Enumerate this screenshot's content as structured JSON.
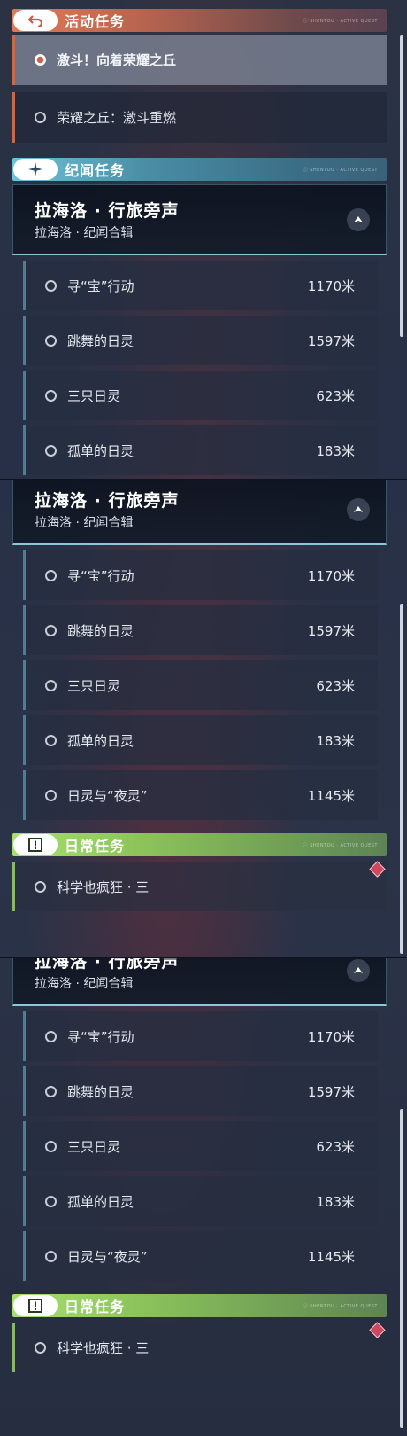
{
  "activity": {
    "title": "活动任务",
    "badge_icon": "return-arrow-icon",
    "tag": "ⓘ SHENTOU · ACTIVE QUEST",
    "items": [
      {
        "label": "激斗！向着荣耀之丘",
        "selected": true
      },
      {
        "label": "荣耀之丘：激斗重燃",
        "selected": false
      }
    ],
    "accent": "#c66a4e"
  },
  "chronicle": {
    "title": "纪闻任务",
    "badge_icon": "sparkle-star-icon",
    "tag": "ⓘ SHENTOU · ACTIVE QUEST",
    "group": {
      "title": "拉海洛 · 行旅旁声",
      "subtitle": "拉海洛 · 纪闻合辑",
      "collapse_icon": "chevron-up-icon"
    },
    "items": [
      {
        "label": "寻“宝”行动",
        "distance": "1170米"
      },
      {
        "label": "跳舞的日灵",
        "distance": "1597米"
      },
      {
        "label": "三只日灵",
        "distance": "623米"
      },
      {
        "label": "孤单的日灵",
        "distance": "183米"
      },
      {
        "label": "日灵与“夜灵”",
        "distance": "1145米"
      }
    ],
    "accent": "#4b7f95"
  },
  "daily": {
    "title": "日常任务",
    "badge_icon": "exclamation-box-icon",
    "tag": "ⓘ SHENTOU · ACTIVE QUEST",
    "items": [
      {
        "label": "科学也疯狂 · 三",
        "marker_icon": "diamond-marker-icon"
      }
    ],
    "accent": "#8ab86a"
  }
}
